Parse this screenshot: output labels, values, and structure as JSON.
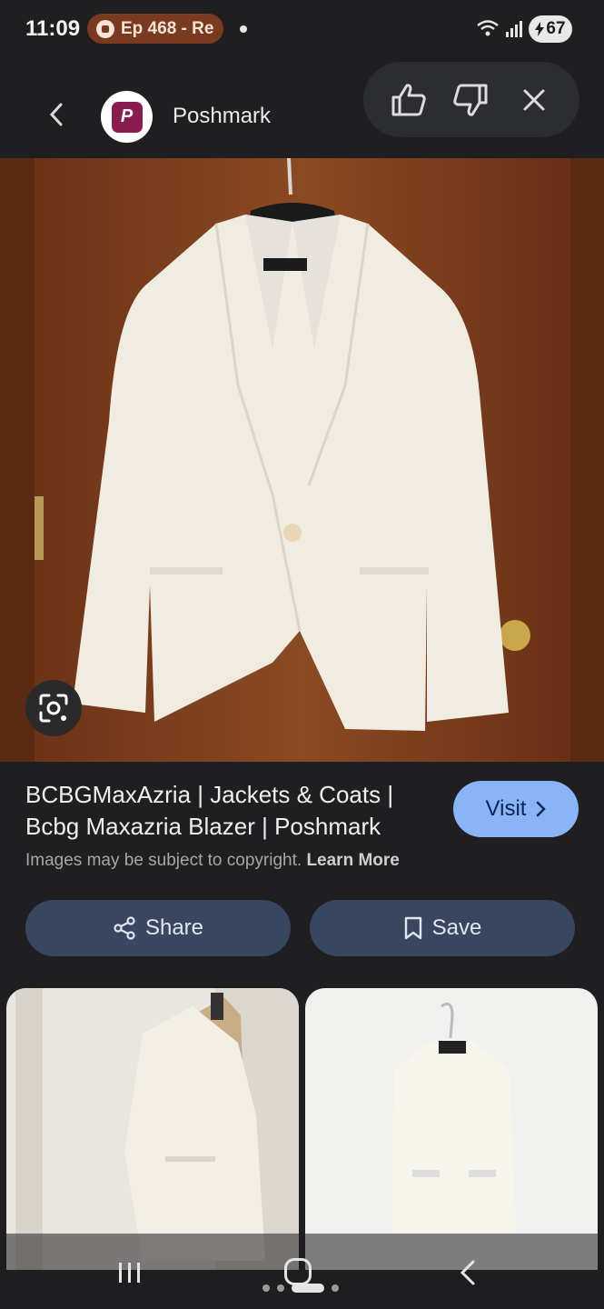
{
  "status_bar": {
    "time": "11:09",
    "media_label": "Ep 468 - Re",
    "battery": "67"
  },
  "header": {
    "site_name": "Poshmark",
    "logo_letter": "P"
  },
  "result": {
    "title": "BCBGMaxAzria | Jackets & Coats | Bcbg Maxazria Blazer | Poshmark",
    "copyright_text": "Images may be subject to copyright.",
    "learn_more": "Learn More",
    "visit_label": "Visit"
  },
  "actions": {
    "share_label": "Share",
    "save_label": "Save"
  },
  "icons": {
    "back": "chevron-left-icon",
    "thumbs_up": "thumbs-up-icon",
    "thumbs_down": "thumbs-down-icon",
    "close": "close-icon",
    "lens": "google-lens-icon",
    "share": "share-icon",
    "save": "bookmark-icon"
  },
  "colors": {
    "accent": "#8ab4f8",
    "button_bg": "#38475f",
    "brand": "#8a1d4f"
  }
}
